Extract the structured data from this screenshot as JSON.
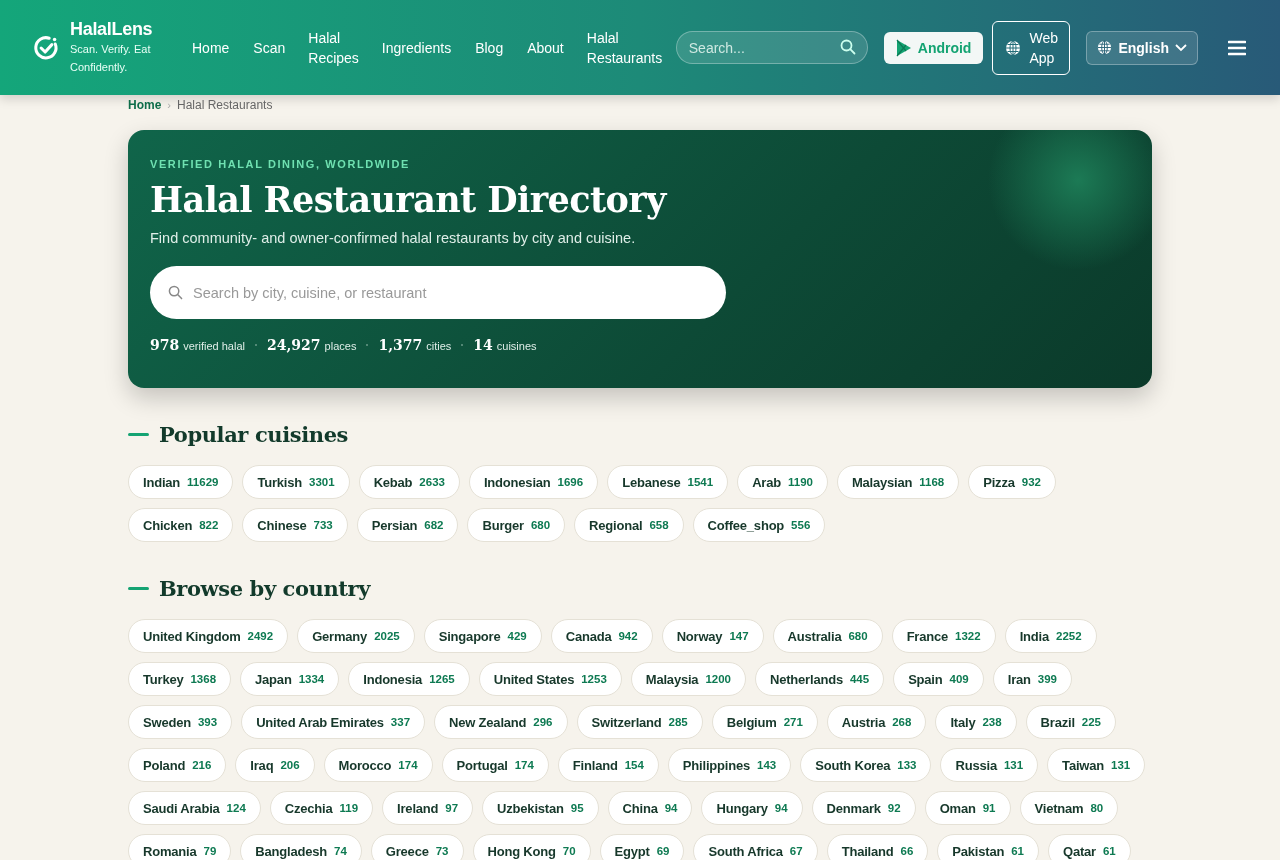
{
  "header": {
    "brand": "HalalLens",
    "tagline": "Scan. Verify. Eat Confidently.",
    "nav": [
      {
        "label": "Home"
      },
      {
        "label": "Scan"
      },
      {
        "label": "Halal Recipes"
      },
      {
        "label": "Ingredients"
      },
      {
        "label": "Blog"
      },
      {
        "label": "About"
      },
      {
        "label": "Halal Restaurants"
      }
    ],
    "search": {
      "placeholder": "Search..."
    },
    "android_button": "Android",
    "webapp_button": "Web App",
    "language": "English"
  },
  "breadcrumb_separator": "›",
  "breadcrumb": [
    {
      "label": "Home"
    },
    {
      "label": "Halal Restaurants"
    }
  ],
  "hero": {
    "eyebrow": "VERIFIED HALAL DINING, WORLDWIDE",
    "title": "Halal Restaurant Directory",
    "subtitle": "Find community- and owner-confirmed halal restaurants by city and cuisine.",
    "search": {
      "placeholder": "Search by city, cuisine, or restaurant"
    },
    "stats": [
      {
        "value": "978",
        "label": "verified halal"
      },
      {
        "value": "24,927",
        "label": "places"
      },
      {
        "value": "1,377",
        "label": "cities"
      },
      {
        "value": "14",
        "label": "cuisines"
      }
    ]
  },
  "sections": [
    {
      "title": "Popular cuisines",
      "chips": [
        {
          "name": "Indian",
          "count": "11629"
        },
        {
          "name": "Turkish",
          "count": "3301"
        },
        {
          "name": "Kebab",
          "count": "2633"
        },
        {
          "name": "Indonesian",
          "count": "1696"
        },
        {
          "name": "Lebanese",
          "count": "1541"
        },
        {
          "name": "Arab",
          "count": "1190"
        },
        {
          "name": "Malaysian",
          "count": "1168"
        },
        {
          "name": "Pizza",
          "count": "932"
        },
        {
          "name": "Chicken",
          "count": "822"
        },
        {
          "name": "Chinese",
          "count": "733"
        },
        {
          "name": "Persian",
          "count": "682"
        },
        {
          "name": "Burger",
          "count": "680"
        },
        {
          "name": "Regional",
          "count": "658"
        },
        {
          "name": "Coffee_shop",
          "count": "556"
        }
      ]
    },
    {
      "title": "Browse by country",
      "chips": [
        {
          "name": "United Kingdom",
          "count": "2492"
        },
        {
          "name": "Germany",
          "count": "2025"
        },
        {
          "name": "Singapore",
          "count": "429"
        },
        {
          "name": "Canada",
          "count": "942"
        },
        {
          "name": "Norway",
          "count": "147"
        },
        {
          "name": "Australia",
          "count": "680"
        },
        {
          "name": "France",
          "count": "1322"
        },
        {
          "name": "India",
          "count": "2252"
        },
        {
          "name": "Turkey",
          "count": "1368"
        },
        {
          "name": "Japan",
          "count": "1334"
        },
        {
          "name": "Indonesia",
          "count": "1265"
        },
        {
          "name": "United States",
          "count": "1253"
        },
        {
          "name": "Malaysia",
          "count": "1200"
        },
        {
          "name": "Netherlands",
          "count": "445"
        },
        {
          "name": "Spain",
          "count": "409"
        },
        {
          "name": "Iran",
          "count": "399"
        },
        {
          "name": "Sweden",
          "count": "393"
        },
        {
          "name": "United Arab Emirates",
          "count": "337"
        },
        {
          "name": "New Zealand",
          "count": "296"
        },
        {
          "name": "Switzerland",
          "count": "285"
        },
        {
          "name": "Belgium",
          "count": "271"
        },
        {
          "name": "Austria",
          "count": "268"
        },
        {
          "name": "Italy",
          "count": "238"
        },
        {
          "name": "Brazil",
          "count": "225"
        },
        {
          "name": "Poland",
          "count": "216"
        },
        {
          "name": "Iraq",
          "count": "206"
        },
        {
          "name": "Morocco",
          "count": "174"
        },
        {
          "name": "Portugal",
          "count": "174"
        },
        {
          "name": "Finland",
          "count": "154"
        },
        {
          "name": "Philippines",
          "count": "143"
        },
        {
          "name": "South Korea",
          "count": "133"
        },
        {
          "name": "Russia",
          "count": "131"
        },
        {
          "name": "Taiwan",
          "count": "131"
        },
        {
          "name": "Saudi Arabia",
          "count": "124"
        },
        {
          "name": "Czechia",
          "count": "119"
        },
        {
          "name": "Ireland",
          "count": "97"
        },
        {
          "name": "Uzbekistan",
          "count": "95"
        },
        {
          "name": "China",
          "count": "94"
        },
        {
          "name": "Hungary",
          "count": "94"
        },
        {
          "name": "Denmark",
          "count": "92"
        },
        {
          "name": "Oman",
          "count": "91"
        },
        {
          "name": "Vietnam",
          "count": "80"
        },
        {
          "name": "Romania",
          "count": "79"
        },
        {
          "name": "Bangladesh",
          "count": "74"
        },
        {
          "name": "Greece",
          "count": "73"
        },
        {
          "name": "Hong Kong",
          "count": "70"
        },
        {
          "name": "Egypt",
          "count": "69"
        },
        {
          "name": "South Africa",
          "count": "67"
        },
        {
          "name": "Thailand",
          "count": "66"
        },
        {
          "name": "Pakistan",
          "count": "61"
        },
        {
          "name": "Qatar",
          "count": "61"
        }
      ]
    }
  ]
}
